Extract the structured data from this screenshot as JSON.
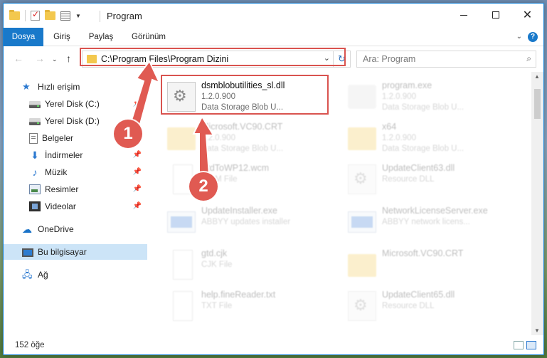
{
  "window": {
    "title": "Program",
    "buttons": {
      "minimize": "—",
      "maximize": "☐",
      "close": "✕"
    }
  },
  "ribbon": {
    "tabs": [
      {
        "label": "Dosya"
      },
      {
        "label": "Giriş"
      },
      {
        "label": "Paylaş"
      },
      {
        "label": "Görünüm"
      }
    ],
    "help": "?"
  },
  "address": {
    "path": "C:\\Program Files\\Program Dizini"
  },
  "search": {
    "placeholder": "Ara: Program"
  },
  "sidebar": {
    "items": [
      {
        "label": "Hızlı erişim",
        "icon": "star-icon"
      },
      {
        "label": "Yerel Disk (C:)",
        "icon": "drive-icon"
      },
      {
        "label": "Yerel Disk (D:)",
        "icon": "drive-icon"
      },
      {
        "label": "Belgeler",
        "icon": "documents-icon"
      },
      {
        "label": "İndirmeler",
        "icon": "download-icon"
      },
      {
        "label": "Müzik",
        "icon": "music-icon"
      },
      {
        "label": "Resimler",
        "icon": "pictures-icon"
      },
      {
        "label": "Videolar",
        "icon": "videos-icon"
      },
      {
        "label": "OneDrive",
        "icon": "onedrive-icon"
      },
      {
        "label": "Bu bilgisayar",
        "icon": "computer-icon"
      },
      {
        "label": "Ağ",
        "icon": "network-icon"
      }
    ]
  },
  "files": [
    {
      "name": "dsmblobutilities_sl.dll",
      "line2": "1.2.0.900",
      "line3": "Data Storage Blob U...",
      "icon": "dll-icon"
    },
    {
      "name": "program.exe",
      "line2": "1.2.0.900",
      "line3": "Data Storage Blob U...",
      "icon": "app-icon"
    },
    {
      "name": "Microsoft.VC90.CRT",
      "line2": "1.2.0.900",
      "line3": "Data Storage Blob U...",
      "icon": "folder-icon"
    },
    {
      "name": "x64",
      "line2": "1.2.0.900",
      "line3": "Data Storage Blob U...",
      "icon": "folder-icon"
    },
    {
      "name": "StdToWP12.wcm",
      "line2": "WCM File",
      "line3": "",
      "icon": "file-icon"
    },
    {
      "name": "UpdateClient63.dll",
      "line2": "Resource DLL",
      "line3": "",
      "icon": "dll-icon"
    },
    {
      "name": "UpdateInstaller.exe",
      "line2": "ABBYY updates installer",
      "line3": "",
      "icon": "exe-icon"
    },
    {
      "name": "NetworkLicenseServer.exe",
      "line2": "ABBYY network licens...",
      "line3": "",
      "icon": "exe-icon"
    },
    {
      "name": "gtd.cjk",
      "line2": "CJK File",
      "line3": "",
      "icon": "file-icon"
    },
    {
      "name": "Microsoft.VC90.CRT",
      "line2": "",
      "line3": "",
      "icon": "folder-icon"
    },
    {
      "name": "help.fineReader.txt",
      "line2": "TXT File",
      "line3": "",
      "icon": "file-icon"
    },
    {
      "name": "UpdateClient65.dll",
      "line2": "Resource DLL",
      "line3": "",
      "icon": "dll-icon"
    }
  ],
  "status": {
    "count": "152 öğe"
  },
  "annotations": {
    "step1": "1",
    "step2": "2",
    "color": "#e05a52"
  }
}
